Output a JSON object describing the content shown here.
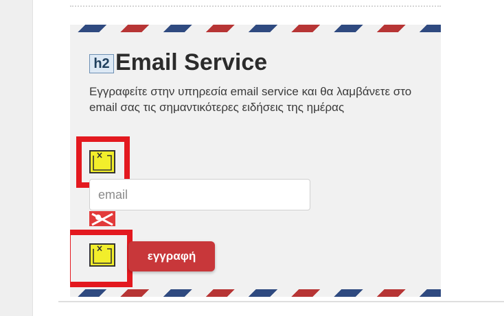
{
  "widget": {
    "heading_tag": "h2",
    "title": "Email Service",
    "description": "Εγγραφείτε στην υπηρεσία email service και θα λαμβάνετε στο email σας τις σημαντικότερες ειδήσεις της ημέρας"
  },
  "form": {
    "email_placeholder": "email",
    "email_value": "",
    "subscribe_label": "εγγραφή"
  },
  "colors": {
    "button": "#c8373a",
    "highlight": "#e3191f",
    "airmail_blue": "#2f4a80",
    "airmail_red": "#b73535"
  },
  "icons": [
    "broken-image-icon",
    "error-icon"
  ]
}
